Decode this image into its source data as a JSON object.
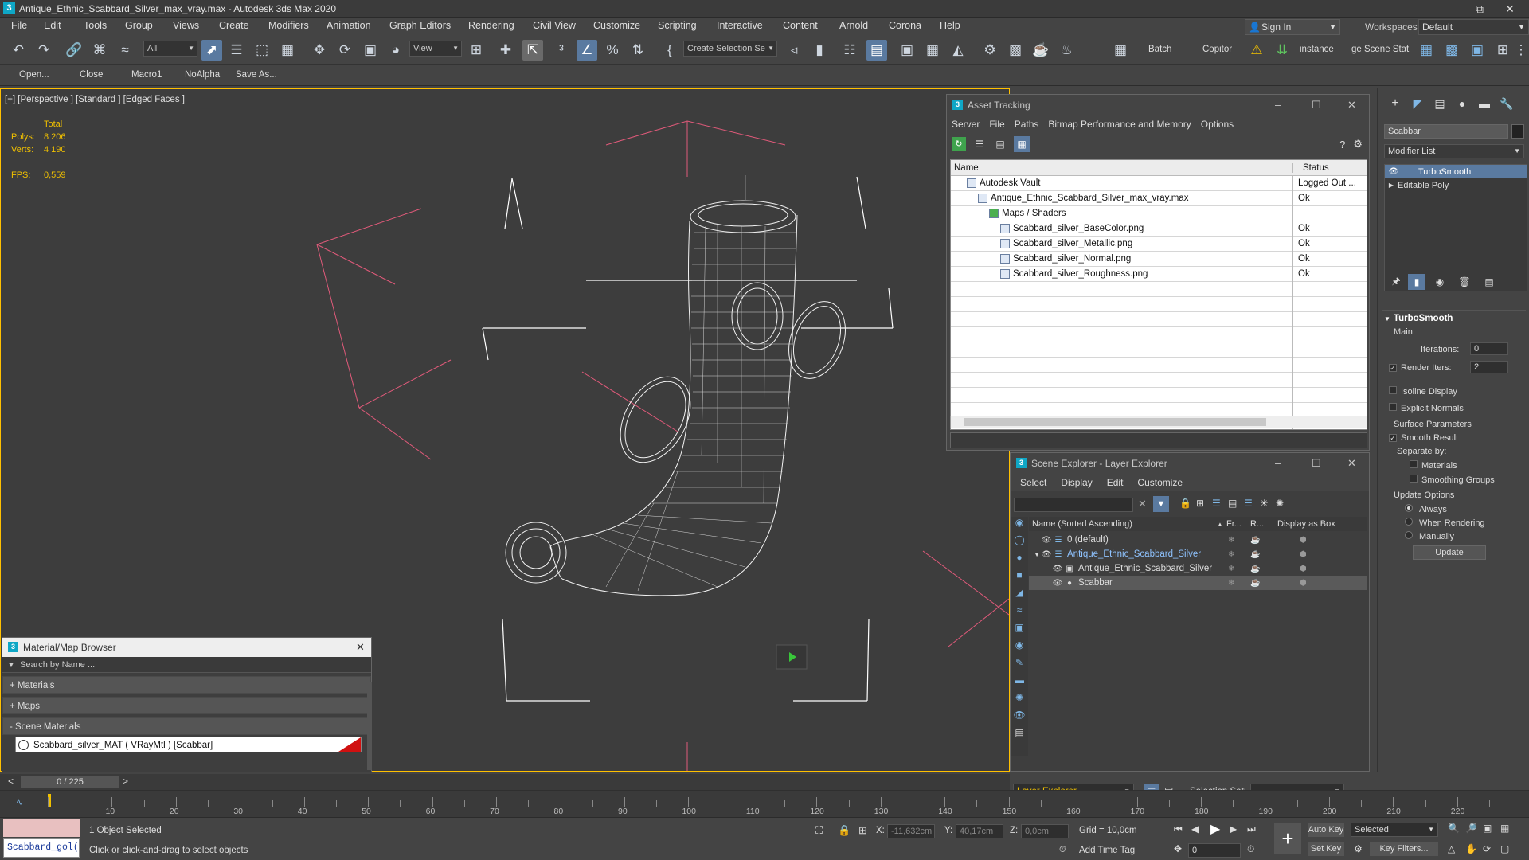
{
  "window": {
    "title": "Antique_Ethnic_Scabbard_Silver_max_vray.max - Autodesk 3ds Max 2020",
    "app_icon": "3"
  },
  "menus": [
    "File",
    "Edit",
    "Tools",
    "Group",
    "Views",
    "Create",
    "Modifiers",
    "Animation",
    "Graph Editors",
    "Rendering",
    "Civil View",
    "Customize",
    "Scripting",
    "Interactive",
    "Content",
    "Arnold",
    "Corona",
    "Help"
  ],
  "signin": "Sign In",
  "workspaces_label": "Workspaces:",
  "workspace_value": "Default",
  "toolbar": {
    "filter_select": "All",
    "refcoord_select": "View",
    "selection_set_select": "Create Selection Se",
    "batch": "Batch",
    "copitor": "Copitor",
    "instance": "instance",
    "scene_stat": "ge Scene Stat"
  },
  "toolbar2": [
    "Open...",
    "Close",
    "Macro1",
    "NoAlpha",
    "Save As..."
  ],
  "viewport": {
    "label": "[+] [Perspective ] [Standard ] [Edged Faces ]",
    "stats": {
      "total_label": "Total",
      "polys_label": "Polys:",
      "polys": "8 206",
      "verts_label": "Verts:",
      "verts": "4 190",
      "fps_label": "FPS:",
      "fps": "0,559"
    }
  },
  "asset_tracking": {
    "title": "Asset Tracking",
    "menu": [
      "Server",
      "File",
      "Paths",
      "Bitmap Performance and Memory",
      "Options"
    ],
    "col_name": "Name",
    "col_status": "Status",
    "rows": [
      {
        "name": "Autodesk Vault",
        "status": "Logged Out ...",
        "indent": 0
      },
      {
        "name": "Antique_Ethnic_Scabbard_Silver_max_vray.max",
        "status": "Ok",
        "indent": 1
      },
      {
        "name": "Maps / Shaders",
        "status": "",
        "indent": 2
      },
      {
        "name": "Scabbard_silver_BaseColor.png",
        "status": "Ok",
        "indent": 3
      },
      {
        "name": "Scabbard_silver_Metallic.png",
        "status": "Ok",
        "indent": 3
      },
      {
        "name": "Scabbard_silver_Normal.png",
        "status": "Ok",
        "indent": 3
      },
      {
        "name": "Scabbard_silver_Roughness.png",
        "status": "Ok",
        "indent": 3
      }
    ]
  },
  "scene_explorer": {
    "title": "Scene Explorer - Layer Explorer",
    "menu": [
      "Select",
      "Display",
      "Edit",
      "Customize"
    ],
    "col_name": "Name (Sorted Ascending)",
    "col_fr": "Fr...",
    "col_r": "R...",
    "col_box": "Display as Box",
    "rows": [
      {
        "name": "0 (default)",
        "level": 0,
        "selected": false
      },
      {
        "name": "Antique_Ethnic_Scabbard_Silver",
        "level": 0,
        "selected": false,
        "highlight": true
      },
      {
        "name": "Antique_Ethnic_Scabbard_Silver",
        "level": 1,
        "selected": false
      },
      {
        "name": "Scabbar",
        "level": 1,
        "selected": true
      }
    ],
    "footer_select": "Layer Explorer",
    "selection_set_label": "Selection Set:"
  },
  "command_panel": {
    "object_name": "Scabbar",
    "modifier_list": "Modifier List",
    "stack": [
      "TurboSmooth",
      "Editable Poly"
    ],
    "rollout_title": "TurboSmooth",
    "main_label": "Main",
    "iterations_label": "Iterations:",
    "iterations": "0",
    "render_iters_label": "Render Iters:",
    "render_iters": "2",
    "isoline": "Isoline Display",
    "explicit_normals": "Explicit Normals",
    "surface_params": "Surface Parameters",
    "smooth_result": "Smooth Result",
    "separate_by": "Separate by:",
    "materials": "Materials",
    "smoothing_groups": "Smoothing Groups",
    "update_options": "Update Options",
    "always": "Always",
    "when_rendering": "When Rendering",
    "manually": "Manually",
    "update_button": "Update"
  },
  "material_browser": {
    "title": "Material/Map Browser",
    "search_placeholder": "Search by Name ...",
    "sections": [
      "+ Materials",
      "+ Maps",
      "- Scene Materials"
    ],
    "material_item": "Scabbard_silver_MAT  ( VRayMtl )  [Scabbar]"
  },
  "timeline": {
    "frame_label": "0 / 225",
    "ticks": [
      "10",
      "20",
      "30",
      "40",
      "50",
      "60",
      "70",
      "80",
      "90",
      "100",
      "110",
      "120",
      "130",
      "140",
      "150",
      "160",
      "170",
      "180",
      "190",
      "200",
      "210",
      "220"
    ]
  },
  "status": {
    "selected": "1 Object Selected",
    "prompt": "Click or click-and-drag to select objects",
    "maxscript": "Scabbard_gol(",
    "x_label": "X:",
    "x": "-11,632cm",
    "y_label": "Y:",
    "y": "40,17cm",
    "z_label": "Z:",
    "z": "0,0cm",
    "grid": "Grid = 10,0cm",
    "add_time_tag": "Add Time Tag",
    "auto_key": "Auto Key",
    "set_key": "Set Key",
    "selected_select": "Selected",
    "key_filters": "Key Filters...",
    "frame_field": "0"
  }
}
